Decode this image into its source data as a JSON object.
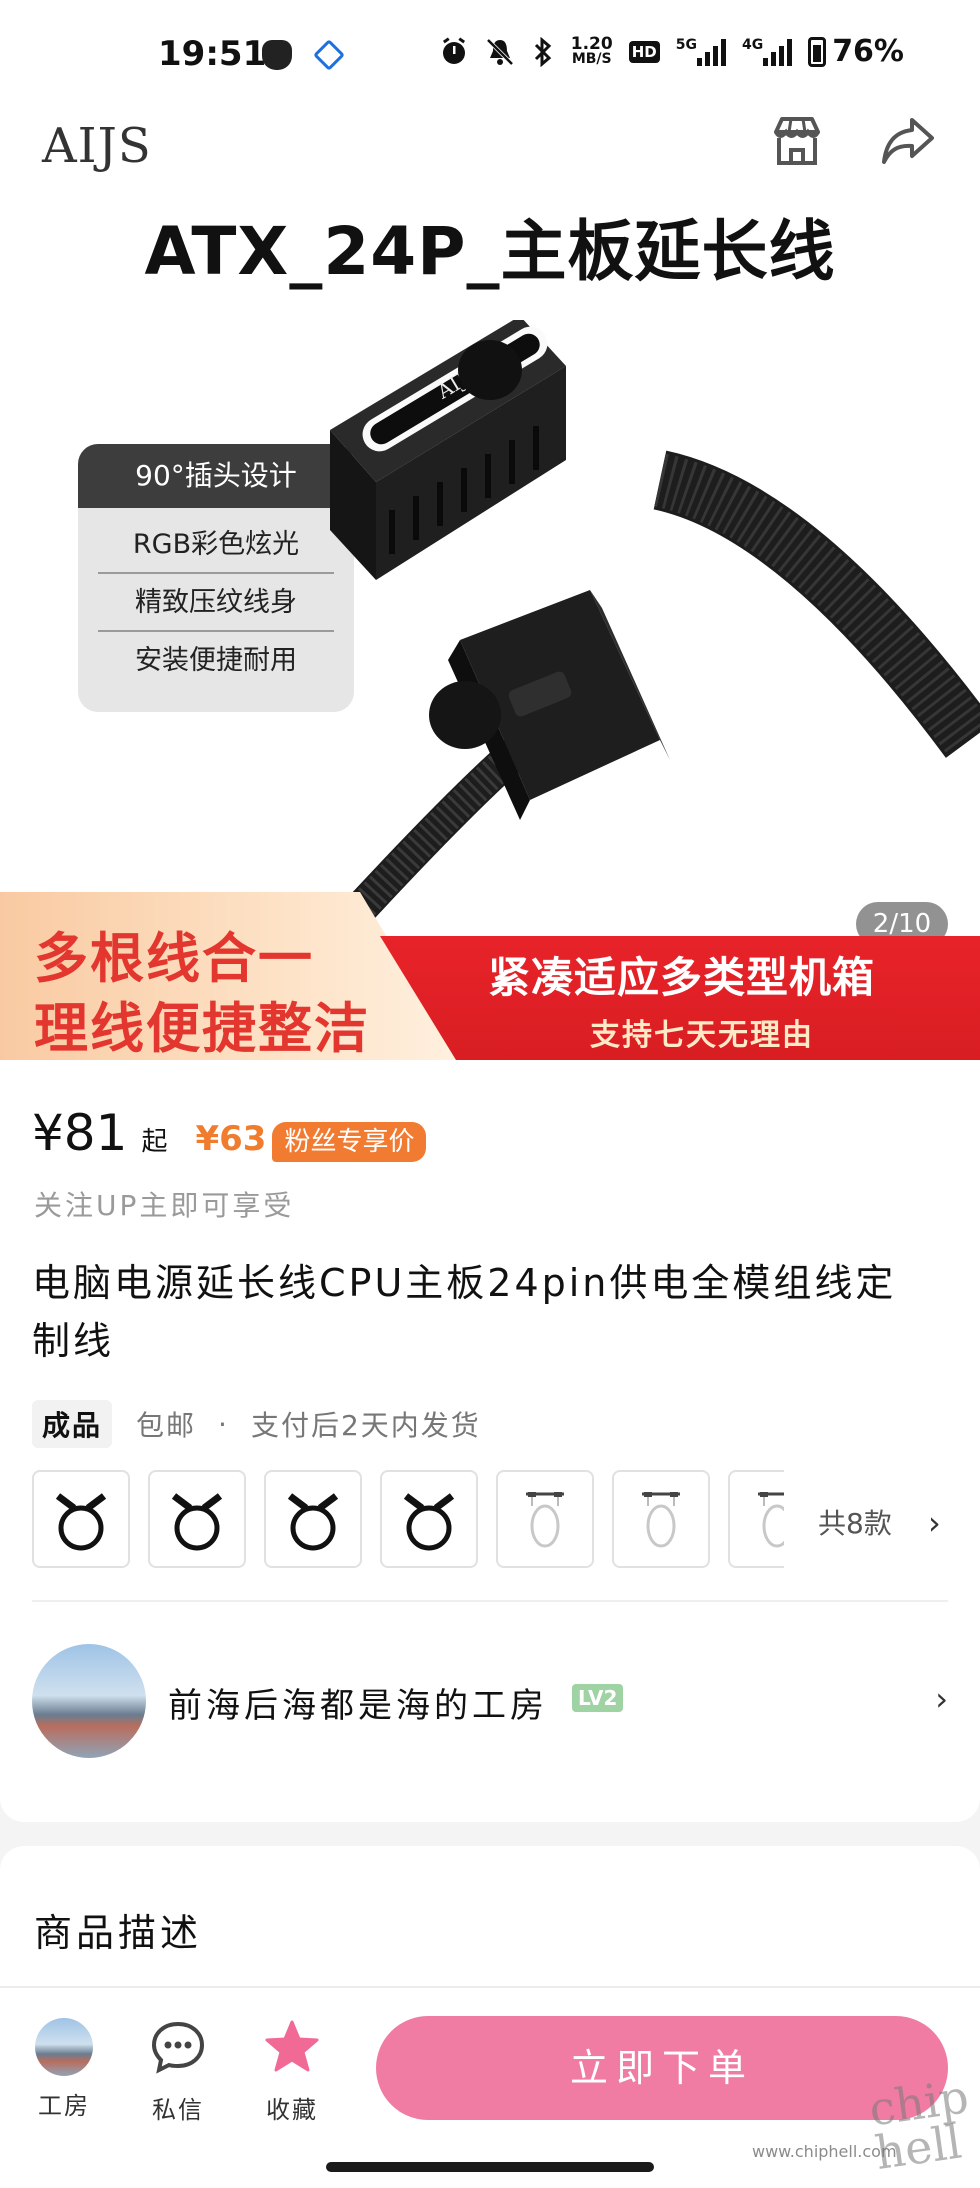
{
  "status_bar": {
    "time": "19:51",
    "net_speed_value": "1.20",
    "net_speed_unit": "MB/S",
    "hd_label": "HD",
    "net1": "5G",
    "net2": "4G",
    "battery": "76%"
  },
  "top_nav": {
    "brand": "AIJS",
    "shop_icon": "storefront-icon",
    "share_icon": "share-icon"
  },
  "product_image": {
    "title": "ATX_24P_主板延长线",
    "device_logo": "AIJS",
    "feature_header": "90°插头设计",
    "features": [
      "RGB彩色炫光",
      "精致压纹线身",
      "安装便捷耐用"
    ],
    "counter": "2/10",
    "banner_left": [
      "多根线合一",
      "理线便捷整洁"
    ],
    "banner_right_main": "紧凑适应多类型机箱",
    "banner_right_sub": "支持七天无理由"
  },
  "price": {
    "main": "¥81",
    "suffix": "起",
    "fan_price": "¥63",
    "fan_badge": "粉丝专享价",
    "note": "关注UP主即可享受"
  },
  "product": {
    "title": "电脑电源延长线CPU主板24pin供电全模组线定制线",
    "tag": "成品",
    "shipping": "包邮",
    "separator": "·",
    "dispatch": "支付后2天内发货"
  },
  "variants": {
    "count_label": "共8款",
    "items": [
      "black-cable-variant",
      "black-cable-variant",
      "black-cable-variant",
      "black-cable-variant",
      "white-cable-variant",
      "white-cable-variant",
      "white-cable-variant"
    ]
  },
  "shop": {
    "name": "前海后海都是海的工房",
    "level": "LV2"
  },
  "description": {
    "title": "商品描述"
  },
  "bottom_bar": {
    "tabs": [
      {
        "label": "工房",
        "icon": "shop-avatar-icon"
      },
      {
        "label": "私信",
        "icon": "chat-bubble-icon"
      },
      {
        "label": "收藏",
        "icon": "star-icon"
      }
    ],
    "order_button": "立即下单"
  },
  "watermark": {
    "logo": "chip hell",
    "url": "www.chiphell.com"
  },
  "colors": {
    "accent_pink": "#f07ca4",
    "fan_orange": "#f07d2e",
    "banner_red": "#e3362f",
    "level_green": "#9fd3a3"
  }
}
